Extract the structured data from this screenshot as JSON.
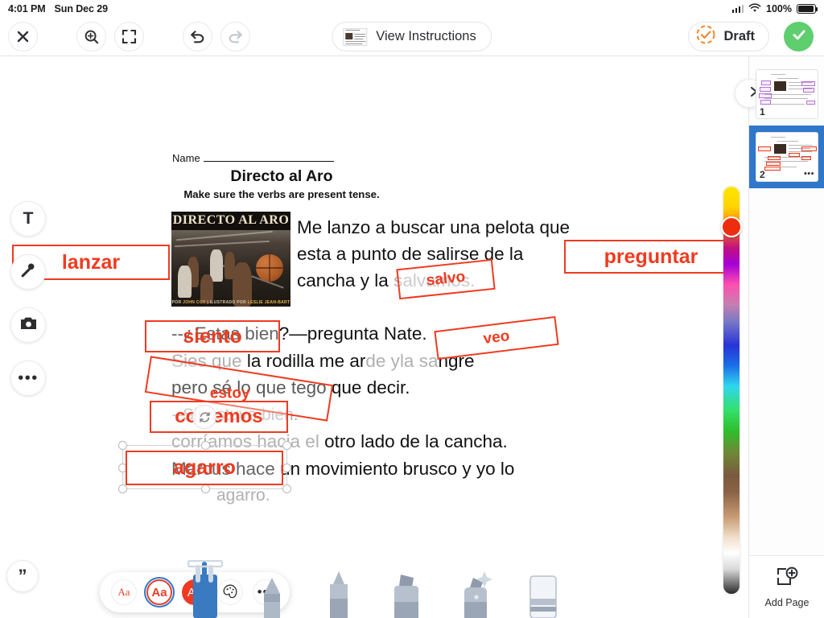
{
  "status_bar": {
    "time": "4:01 PM",
    "date": "Sun Dec 29",
    "battery_percent": "100%",
    "signal_icon": "cellular-bars-icon",
    "wifi_icon": "wifi-icon",
    "battery_icon": "battery-full-icon"
  },
  "toolbar": {
    "close_icon": "close-icon",
    "zoom_icon": "zoom-in-icon",
    "fullscreen_icon": "fullscreen-icon",
    "undo_icon": "undo-icon",
    "redo_icon": "redo-icon",
    "instructions_label": "View Instructions",
    "instructions_icon": "document-thumbnail-icon",
    "status_label": "Draft",
    "status_icon": "dashed-circle-check-icon",
    "status_color": "#f2862a",
    "submit_icon": "checkmark-icon",
    "submit_color": "#5ece6e"
  },
  "left_rail": {
    "items": [
      {
        "name": "text-tool",
        "icon": "text-T-icon"
      },
      {
        "name": "audio-tool",
        "icon": "microphone-icon"
      },
      {
        "name": "camera-tool",
        "icon": "camera-icon"
      },
      {
        "name": "more-tools",
        "icon": "ellipsis-icon"
      }
    ],
    "quote_icon": "quote-icon"
  },
  "worksheet": {
    "name_label": "Name",
    "title": "Directo al Aro",
    "subtitle": "Make sure the verbs are present tense.",
    "cover": {
      "title": "DIRECTO AL ARO",
      "credits_prefix": "POR",
      "credits_author": "JOHN COY",
      "credits_middle": "ILUSTRADO POR",
      "credits_illustrator": "LESLIE JEAN-BART"
    },
    "passage_right": [
      "Me lanzo a buscar una pelota que",
      "esta a punto de salirse de la",
      "cancha y la"
    ],
    "passage_full": [
      "--¿Estas bien?—pregunta Nate.",
      "pero sé lo que tego que decir.",
      "Marcus hace un movimiento brusco y yo lo"
    ],
    "faded_words": {
      "salvamos": "salvamos.",
      "siento_line_a": "Sie",
      "siento_line_b": "s que",
      "arde": "de y",
      "sangre": "la sa",
      "line_siento_rest_1": "la rodilla me ar",
      "line_siento_rest_2": "ngre",
      "estuve_line": "--Si, estuve bien.",
      "corriamos_line": "corríamos hacia el",
      "corriamos_tail": "otro lado de la cancha.",
      "agarro_faded": "agarro."
    },
    "annotations": [
      {
        "name": "annotation-lanzar",
        "text": "lanzar"
      },
      {
        "name": "annotation-preguntar",
        "text": "preguntar"
      },
      {
        "name": "annotation-salvo",
        "text": "salvo"
      },
      {
        "name": "annotation-siento",
        "text": "siento"
      },
      {
        "name": "annotation-veo",
        "text": "veo"
      },
      {
        "name": "annotation-estoy",
        "text": "estoy"
      },
      {
        "name": "annotation-corremos",
        "text": "corremos"
      },
      {
        "name": "annotation-agarro",
        "text": "agarro"
      }
    ],
    "annotation_color": "#ef3b20"
  },
  "format_bar": {
    "items": [
      {
        "name": "font-small",
        "label": "Aa"
      },
      {
        "name": "font-medium-selected",
        "label": "Aa"
      },
      {
        "name": "font-large",
        "label": "Aa"
      },
      {
        "name": "color-palette",
        "label": "",
        "icon": "palette-icon"
      },
      {
        "name": "more-options",
        "label": "•••",
        "icon": "ellipsis-icon"
      }
    ],
    "selected_ring_color": "#2f77c9",
    "accent_color": "#ee3a22"
  },
  "pen_tray": {
    "tools": [
      {
        "name": "hand-select-tool",
        "icon": "hand-icon",
        "active": true
      },
      {
        "name": "pencil-tool",
        "icon": "pencil-icon",
        "active": false
      },
      {
        "name": "pen-tool",
        "icon": "pen-icon",
        "active": false
      },
      {
        "name": "marker-tool",
        "icon": "marker-icon",
        "active": false
      },
      {
        "name": "glitter-pen-tool",
        "icon": "glitter-pen-icon",
        "active": false
      },
      {
        "name": "eraser-tool",
        "icon": "eraser-icon",
        "active": false
      }
    ],
    "active_color": "#3a7ac0"
  },
  "color_slider": {
    "name": "color-picker-slider",
    "selected_color": "#ee2d0e"
  },
  "page_panel": {
    "collapse_icon": "chevron-right-icon",
    "pages": [
      {
        "number": "1",
        "selected": false,
        "dots": ""
      },
      {
        "number": "2",
        "selected": true,
        "dots": "•••"
      }
    ],
    "add_page_label": "Add Page",
    "add_page_icon": "page-plus-icon",
    "selected_highlight": "#2f77c9"
  }
}
